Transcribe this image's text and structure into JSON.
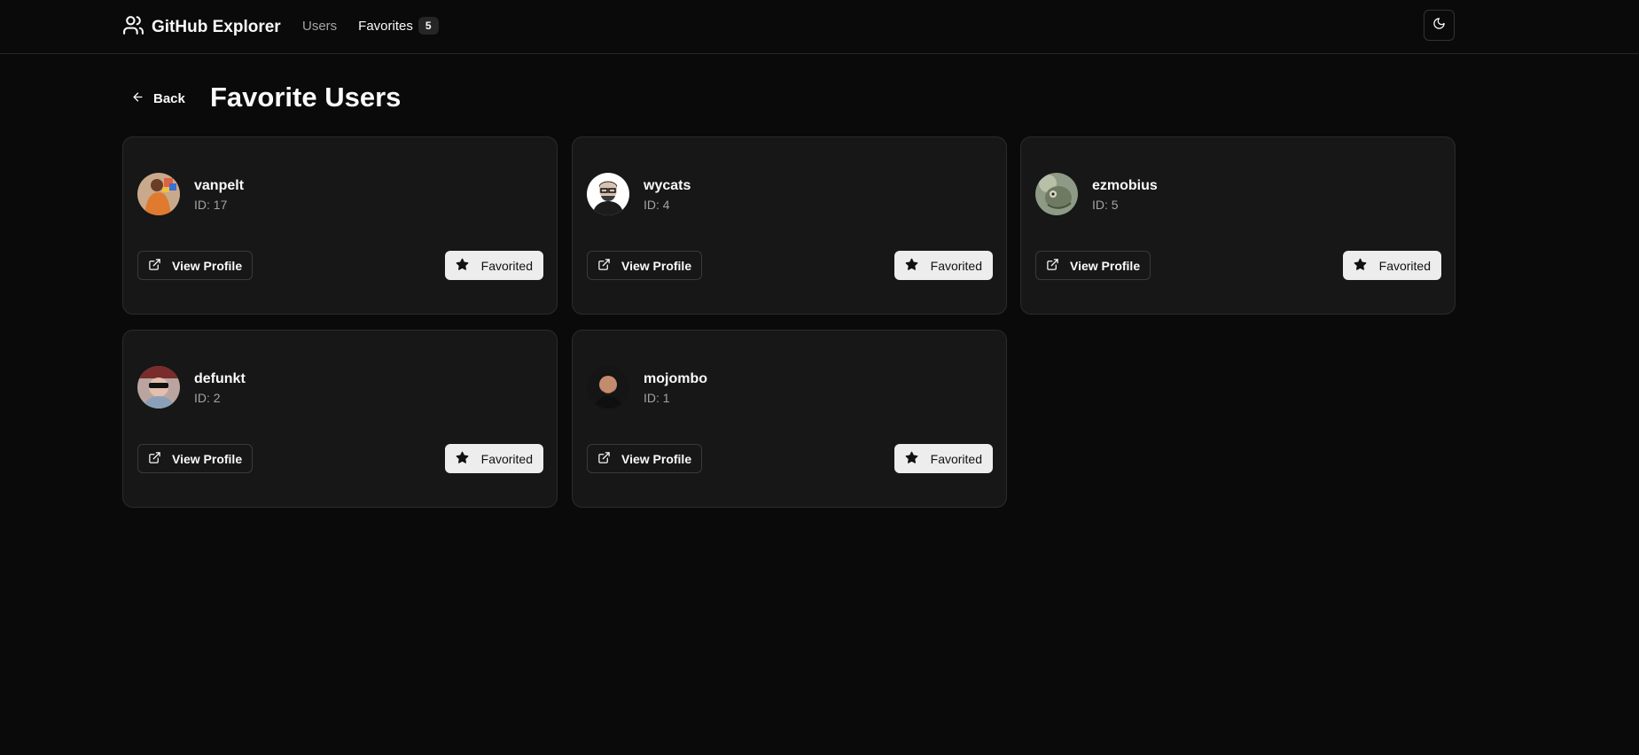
{
  "header": {
    "title": "GitHub Explorer",
    "nav": {
      "users_label": "Users",
      "favorites_label": "Favorites",
      "favorites_count": "5"
    }
  },
  "page": {
    "back_label": "Back",
    "title": "Favorite Users"
  },
  "users": [
    {
      "username": "vanpelt",
      "id_label": "ID: 17",
      "view_label": "View Profile",
      "fav_label": "Favorited"
    },
    {
      "username": "wycats",
      "id_label": "ID: 4",
      "view_label": "View Profile",
      "fav_label": "Favorited"
    },
    {
      "username": "ezmobius",
      "id_label": "ID: 5",
      "view_label": "View Profile",
      "fav_label": "Favorited"
    },
    {
      "username": "defunkt",
      "id_label": "ID: 2",
      "view_label": "View Profile",
      "fav_label": "Favorited"
    },
    {
      "username": "mojombo",
      "id_label": "ID: 1",
      "view_label": "View Profile",
      "fav_label": "Favorited"
    }
  ],
  "icons": {
    "brand": "users-icon",
    "theme": "moon-icon",
    "back": "arrow-left-icon",
    "view": "external-link-icon",
    "favorite": "star-icon"
  },
  "colors": {
    "background": "#0a0a0a",
    "card": "#171717",
    "border": "#262626",
    "muted_text": "#a3a3a3",
    "favorited_button": "#ededed"
  }
}
